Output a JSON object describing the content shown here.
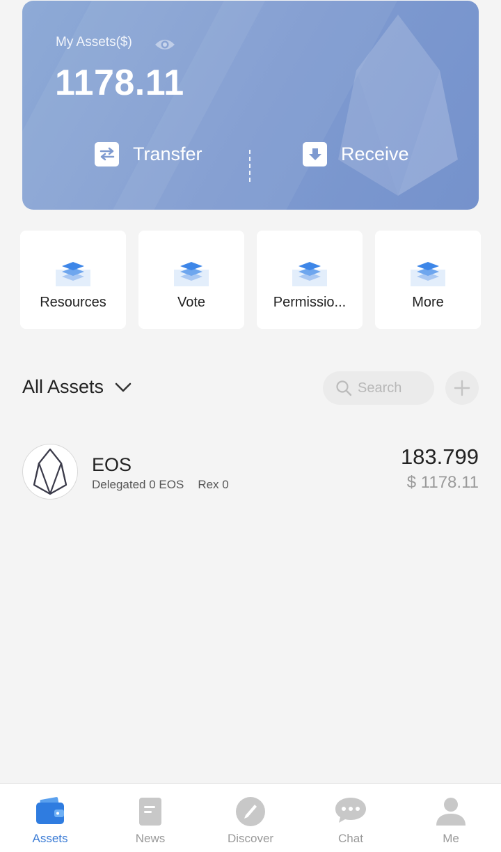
{
  "asset_card": {
    "label": "My Assets($)",
    "total": "1178.11",
    "actions": [
      {
        "label": "Transfer",
        "icon": "transfer-icon"
      },
      {
        "label": "Receive",
        "icon": "receive-icon"
      }
    ]
  },
  "quick_actions": [
    {
      "label": "Resources",
      "icon": "layers-icon"
    },
    {
      "label": "Vote",
      "icon": "layers-icon"
    },
    {
      "label": "Permissio...",
      "icon": "layers-icon"
    },
    {
      "label": "More",
      "icon": "layers-icon"
    }
  ],
  "assets_section": {
    "title": "All Assets",
    "search_placeholder": "Search"
  },
  "tokens": [
    {
      "symbol": "EOS",
      "delegated": "Delegated 0 EOS",
      "rex": "Rex 0",
      "amount": "183.799",
      "value": "$ 1178.11"
    }
  ],
  "bottom_nav": [
    {
      "label": "Assets",
      "icon": "wallet-icon",
      "active": true
    },
    {
      "label": "News",
      "icon": "document-icon",
      "active": false
    },
    {
      "label": "Discover",
      "icon": "compass-icon",
      "active": false
    },
    {
      "label": "Chat",
      "icon": "chat-icon",
      "active": false
    },
    {
      "label": "Me",
      "icon": "person-icon",
      "active": false
    }
  ],
  "colors": {
    "card": "#7e9ad0",
    "accent": "#3a7bd5",
    "background": "#f4f4f4"
  }
}
